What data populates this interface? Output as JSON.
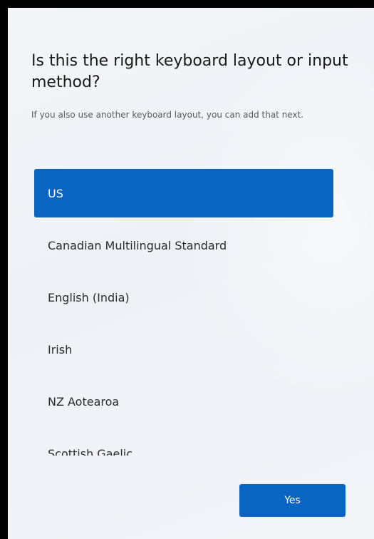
{
  "page": {
    "title": "Is this the right keyboard layout or input method?",
    "subtitle": "If you also use another keyboard layout, you can add that next."
  },
  "layouts": {
    "selected_index": 0,
    "items": [
      {
        "label": "US"
      },
      {
        "label": "Canadian Multilingual Standard"
      },
      {
        "label": "English (India)"
      },
      {
        "label": "Irish"
      },
      {
        "label": "NZ Aotearoa"
      },
      {
        "label": "Scottish Gaelic"
      }
    ]
  },
  "actions": {
    "yes_label": "Yes"
  },
  "colors": {
    "accent": "#0a64c2",
    "background": "#f1f3f7",
    "text": "#1a1a1a"
  }
}
